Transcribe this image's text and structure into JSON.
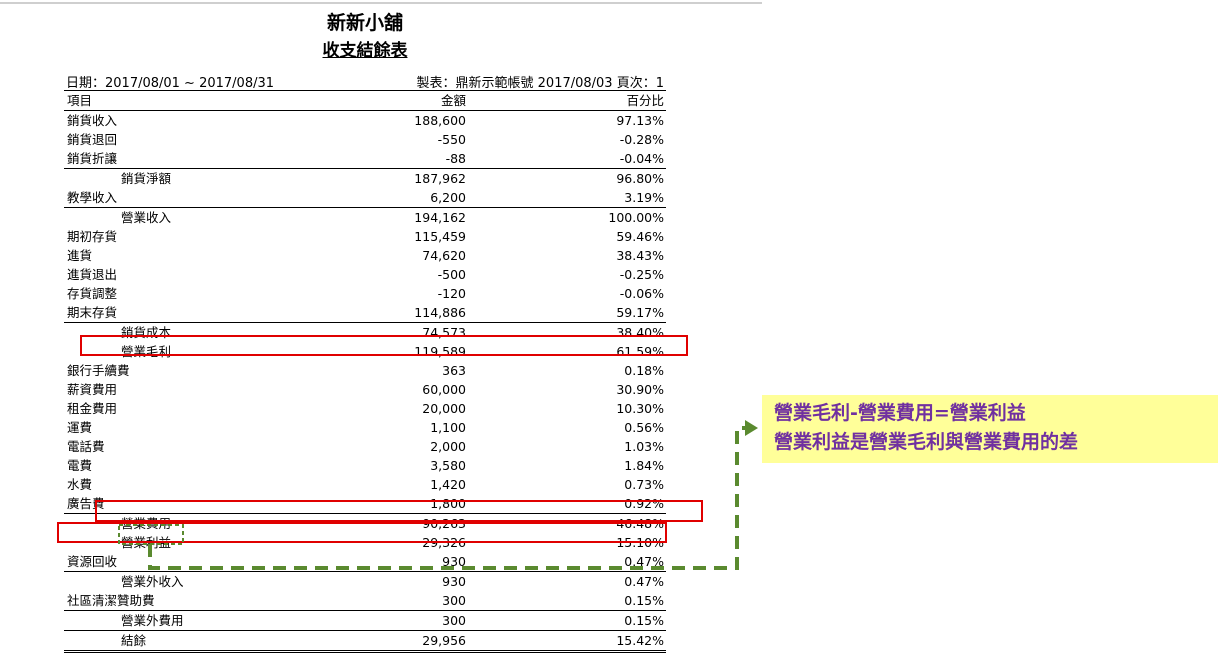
{
  "header": {
    "store_name": "新新小舖",
    "report_name": "收支結餘表",
    "date_range": "日期：2017/08/01 ~ 2017/08/31",
    "maker_info": "製表：鼎新示範帳號 2017/08/03",
    "page_info": "頁次：1"
  },
  "columns": [
    "項目",
    "金額",
    "百分比"
  ],
  "rows": [
    {
      "item": "銷貨收入",
      "amount": "188,600",
      "percent": "97.13%"
    },
    {
      "item": "銷貨退回",
      "amount": "-550",
      "percent": "-0.28%"
    },
    {
      "item": "銷貨折讓",
      "amount": "-88",
      "percent": "-0.04%"
    },
    {
      "item": "銷貨淨額",
      "amount": "187,962",
      "percent": "96.80%"
    },
    {
      "item": "教學收入",
      "amount": "6,200",
      "percent": "3.19%"
    },
    {
      "item": "營業收入",
      "amount": "194,162",
      "percent": "100.00%"
    },
    {
      "item": "期初存貨",
      "amount": "115,459",
      "percent": "59.46%"
    },
    {
      "item": "進貨",
      "amount": "74,620",
      "percent": "38.43%"
    },
    {
      "item": "進貨退出",
      "amount": "-500",
      "percent": "-0.25%"
    },
    {
      "item": "存貨調整",
      "amount": "-120",
      "percent": "-0.06%"
    },
    {
      "item": "期末存貨",
      "amount": "114,886",
      "percent": "59.17%"
    },
    {
      "item": "銷貨成本",
      "amount": "74,573",
      "percent": "38.40%"
    },
    {
      "item": "營業毛利",
      "amount": "119,589",
      "percent": "61.59%"
    },
    {
      "item": "銀行手續費",
      "amount": "363",
      "percent": "0.18%"
    },
    {
      "item": "薪資費用",
      "amount": "60,000",
      "percent": "30.90%"
    },
    {
      "item": "租金費用",
      "amount": "20,000",
      "percent": "10.30%"
    },
    {
      "item": "運費",
      "amount": "1,100",
      "percent": "0.56%"
    },
    {
      "item": "電話費",
      "amount": "2,000",
      "percent": "1.03%"
    },
    {
      "item": "電費",
      "amount": "3,580",
      "percent": "1.84%"
    },
    {
      "item": "水費",
      "amount": "1,420",
      "percent": "0.73%"
    },
    {
      "item": "廣告費",
      "amount": "1,800",
      "percent": "0.92%"
    },
    {
      "item": "營業費用",
      "amount": "90,263",
      "percent": "46.48%"
    },
    {
      "item": "營業利益",
      "amount": "29,326",
      "percent": "15.10%"
    },
    {
      "item": "資源回收",
      "amount": "930",
      "percent": "0.47%"
    },
    {
      "item": "營業外收入",
      "amount": "930",
      "percent": "0.47%"
    },
    {
      "item": "社區清潔贊助費",
      "amount": "300",
      "percent": "0.15%"
    },
    {
      "item": "營業外費用",
      "amount": "300",
      "percent": "0.15%"
    },
    {
      "item": "結餘",
      "amount": "29,956",
      "percent": "15.42%"
    }
  ],
  "annotation": {
    "line1": "營業毛利-營業費用=營業利益",
    "line2": "營業利益是營業毛利與營業費用的差",
    "text_color": "#7030a0",
    "box_color": "#ffff99",
    "highlight_color": "#e00000",
    "arrow_color": "#5a8a2f"
  }
}
